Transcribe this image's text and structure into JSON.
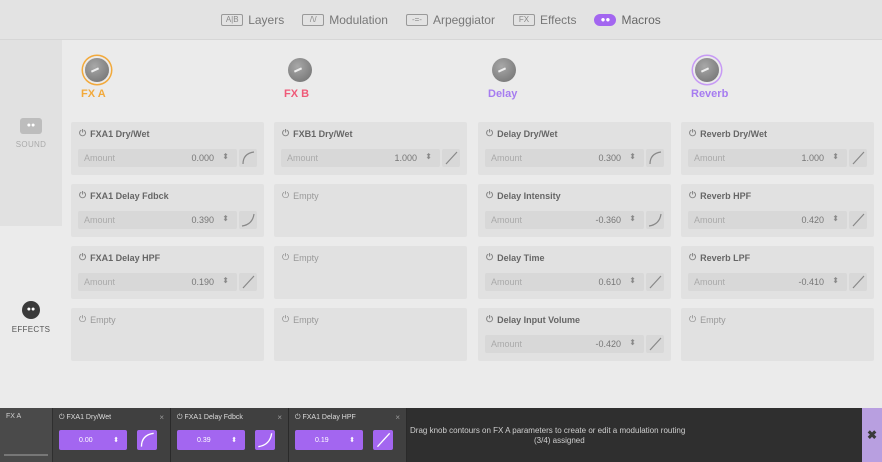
{
  "colors": {
    "fxa": "#f2a93b",
    "fxb": "#ef5a78",
    "delay": "#a67cf0",
    "reverb": "#a67cf0",
    "macro_accent": "#a366f0"
  },
  "tabs": [
    {
      "icon": "layers-icon",
      "icon_text": "A|B",
      "label": "Layers"
    },
    {
      "icon": "modulation-icon",
      "icon_text": "/\\/",
      "label": "Modulation"
    },
    {
      "icon": "arpeggiator-icon",
      "icon_text": "-=-",
      "label": "Arpeggiator"
    },
    {
      "icon": "effects-icon",
      "icon_text": "FX",
      "label": "Effects"
    },
    {
      "icon": "macros-icon",
      "icon_text": "●●",
      "label": "Macros"
    }
  ],
  "sidebar": {
    "sound_label": "SOUND",
    "effects_label": "EFFECTS"
  },
  "macros": [
    {
      "label": "FX A"
    },
    {
      "label": "FX B"
    },
    {
      "label": "Delay"
    },
    {
      "label": "Reverb"
    }
  ],
  "amount_label": "Amount",
  "empty_label": "Empty",
  "slots": [
    [
      {
        "title": "FXA1 Dry/Wet",
        "value": "0.000",
        "curve": "log"
      },
      {
        "title": "FXA1 Delay Fdbck",
        "value": "0.390",
        "curve": "exp"
      },
      {
        "title": "FXA1 Delay HPF",
        "value": "0.190",
        "curve": "linear"
      },
      {
        "title": "Empty"
      }
    ],
    [
      {
        "title": "FXB1 Dry/Wet",
        "value": "1.000",
        "curve": "linear"
      },
      {
        "title": "Empty"
      },
      {
        "title": "Empty"
      },
      {
        "title": "Empty"
      }
    ],
    [
      {
        "title": "Delay Dry/Wet",
        "value": "0.300",
        "curve": "log"
      },
      {
        "title": "Delay Intensity",
        "value": "-0.360",
        "curve": "exp"
      },
      {
        "title": "Delay Time",
        "value": "0.610",
        "curve": "linear"
      },
      {
        "title": "Delay Input Volume",
        "value": "-0.420",
        "curve": "linear"
      }
    ],
    [
      {
        "title": "Reverb Dry/Wet",
        "value": "1.000",
        "curve": "linear"
      },
      {
        "title": "Reverb HPF",
        "value": "0.420",
        "curve": "linear"
      },
      {
        "title": "Reverb LPF",
        "value": "-0.410",
        "curve": "linear"
      },
      {
        "title": "Empty"
      }
    ]
  ],
  "bottom": {
    "source_label": "FX A",
    "slots": [
      {
        "name": "FXA1 Dry/Wet",
        "value": "0.00",
        "curve": "log"
      },
      {
        "name": "FXA1 Delay Fdbck",
        "value": "0.39",
        "curve": "exp"
      },
      {
        "name": "FXA1 Delay HPF",
        "value": "0.19",
        "curve": "linear"
      }
    ],
    "help_text": "Drag knob contours on FX A parameters to create or edit a modulation routing",
    "assigned_text": "(3/4) assigned",
    "close_glyph": "✖"
  }
}
